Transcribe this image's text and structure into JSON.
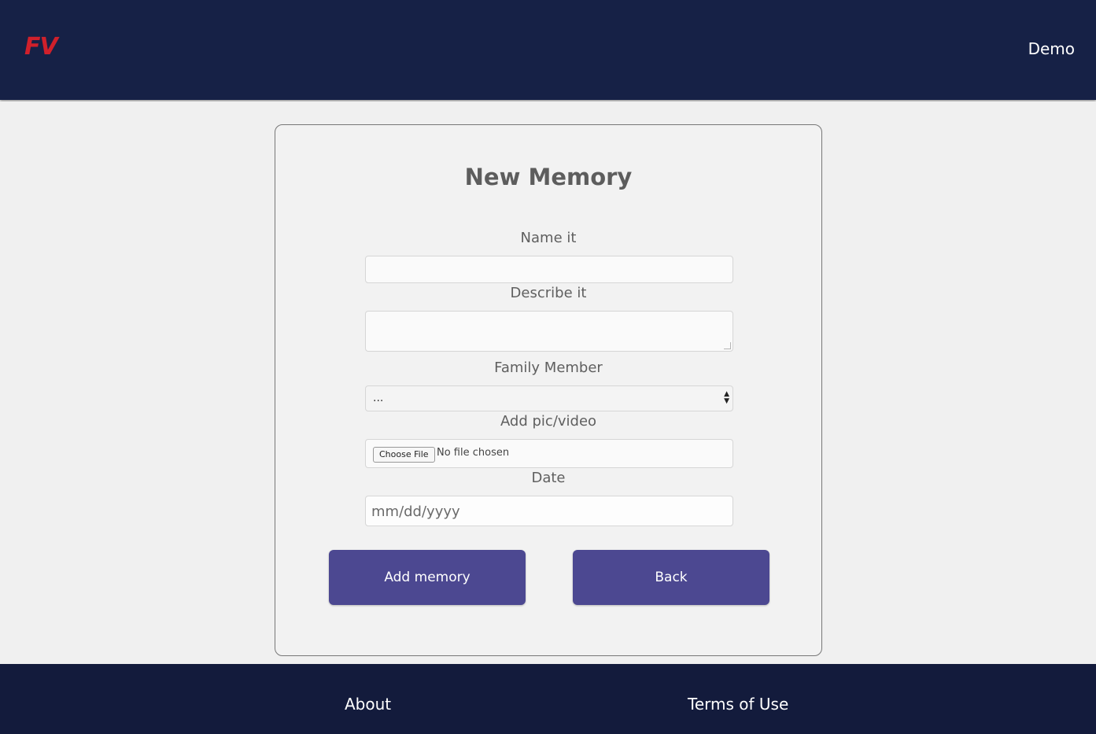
{
  "header": {
    "logo": "FV",
    "nav_demo": "Demo"
  },
  "form": {
    "title": "New Memory",
    "name_label": "Name it",
    "name_value": "",
    "describe_label": "Describe it",
    "describe_value": "",
    "family_label": "Family Member",
    "family_selected": "...",
    "media_label": "Add pic/video",
    "file_button": "Choose File",
    "file_status": "No file chosen",
    "date_label": "Date",
    "date_placeholder": "mm/dd/yyyy",
    "add_button": "Add memory",
    "back_button": "Back"
  },
  "footer": {
    "about": "About",
    "terms": "Terms of Use"
  },
  "colors": {
    "header_bg": "#162146",
    "footer_bg": "#131b3c",
    "logo": "#d0202b",
    "button_bg": "#4c4891"
  },
  "icons": {
    "select_arrows": "updown-arrows-icon",
    "resize_grip": "resize-grip-icon"
  }
}
